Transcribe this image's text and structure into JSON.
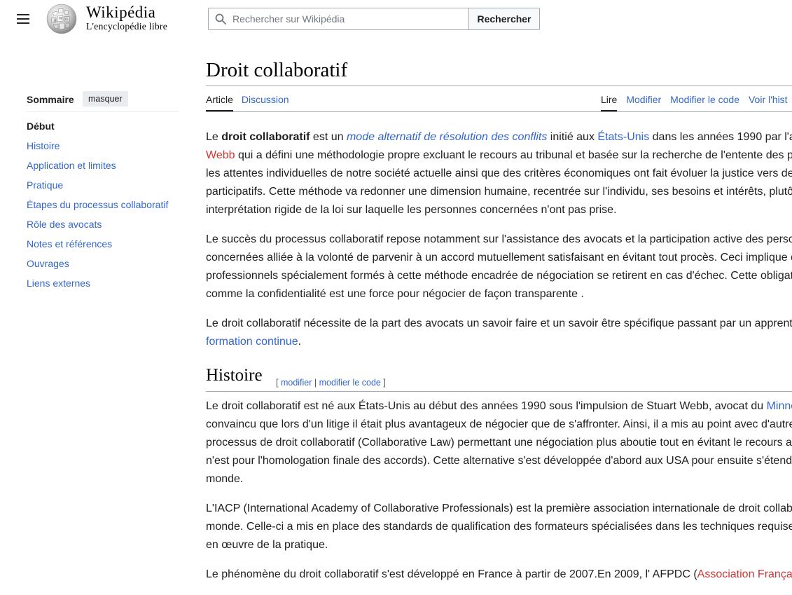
{
  "header": {
    "wordmark_title": "Wikipédia",
    "wordmark_tagline": "L'encyclopédie libre",
    "search_placeholder": "Rechercher sur Wikipédia",
    "search_button": "Rechercher",
    "icons": [
      "menu-icon",
      "wikipedia-globe-logo",
      "search-icon"
    ]
  },
  "toc": {
    "title": "Sommaire",
    "hide_label": "masquer",
    "items": [
      {
        "label": "Début",
        "current": true
      },
      {
        "label": "Histoire"
      },
      {
        "label": "Application et limites"
      },
      {
        "label": "Pratique"
      },
      {
        "label": "Étapes du processus collaboratif"
      },
      {
        "label": "Rôle des avocats"
      },
      {
        "label": "Notes et références"
      },
      {
        "label": "Ouvrages"
      },
      {
        "label": "Liens externes"
      }
    ]
  },
  "page": {
    "title": "Droit collaboratif",
    "tabs_left": [
      "Article",
      "Discussion"
    ],
    "tabs_right": [
      "Lire",
      "Modifier",
      "Modifier le code",
      "Voir l'hist"
    ]
  },
  "intro": {
    "p1": {
      "l1a": "Le ",
      "l1b": "droit collaboratif",
      "l1c": " est un ",
      "l1d": "mode alternatif de résolution des conflits",
      "l1e": " initié aux ",
      "l1f": "États-Unis",
      "l1g": " dans les années 1990 par l'a",
      "l2a": "Webb",
      "l2b": " qui a défini une méthodologie propre excluant le recours au tribunal et basée sur la recherche de l'entente des p",
      "l3": "les attentes individuelles de notre société actuelle ainsi que des critères économiques ont fait évoluer la justice vers de",
      "l4": "participatifs. Cette méthode va redonner une dimension humaine, recentrée sur l'individu, ses besoins et intérêts, plutô",
      "l5": "interprétation rigide de la loi sur laquelle les personnes concernées n'ont pas prise."
    },
    "p2": {
      "l1": "Le succès du processus collaboratif repose notamment sur l'assistance des avocats et la participation active des perso",
      "l2": "concernées alliée à la volonté de parvenir à un accord mutuellement satisfaisant en évitant tout procès. Ceci implique q",
      "l3": "professionnels spécialement formés à cette méthode encadrée de négociation se retirent en cas d'échec. Cette obligat",
      "l4": "comme la confidentialité est une force pour négocier de façon transparente ."
    },
    "p3": {
      "l1": "Le droit collaboratif nécessite de la part des avocats un savoir faire et un savoir être spécifique passant par un apprent",
      "l2": "formation continue",
      "l2end": "."
    }
  },
  "histoire": {
    "heading": "Histoire",
    "edit_open": "[ ",
    "edit": "modifier",
    "edit_sep": " | ",
    "edit_code": "modifier le code",
    "edit_close": " ]",
    "p1": {
      "l1a": "Le droit collaboratif est né aux États-Unis au début des années 1990 sous l'impulsion de Stuart Webb, avocat du ",
      "l1b": "Minne",
      "l2": "convaincu que lors d'un litige il était plus avantageux de négocier que de s'affronter. Ainsi, il a mis au point avec d'autre",
      "l3": "processus de droit collaboratif (Collaborative Law) permettant une négociation plus aboutie tout en évitant le recours a",
      "l4": "n'est pour l'homologation finale des accords). Cette alternative s'est développée d'abord aux USA pour ensuite s'étend",
      "l5": "monde."
    },
    "p2": {
      "l1": "L'IACP (International Academy of Collaborative Professionals) est la première association internationale de droit collab",
      "l2": "monde. Celle-ci a mis en place des standards de qualification des formateurs spécialisées dans les techniques requise",
      "l3": "en œuvre de la pratique."
    },
    "p3": {
      "l1a": "Le phénomène du droit collaboratif s'est développé en France à partir de 2007.En 2009, l' AFPDC (",
      "l1b": "Association França"
    }
  },
  "colors": {
    "link": "#3366cc",
    "red_link": "#d73333",
    "text": "#202122"
  }
}
